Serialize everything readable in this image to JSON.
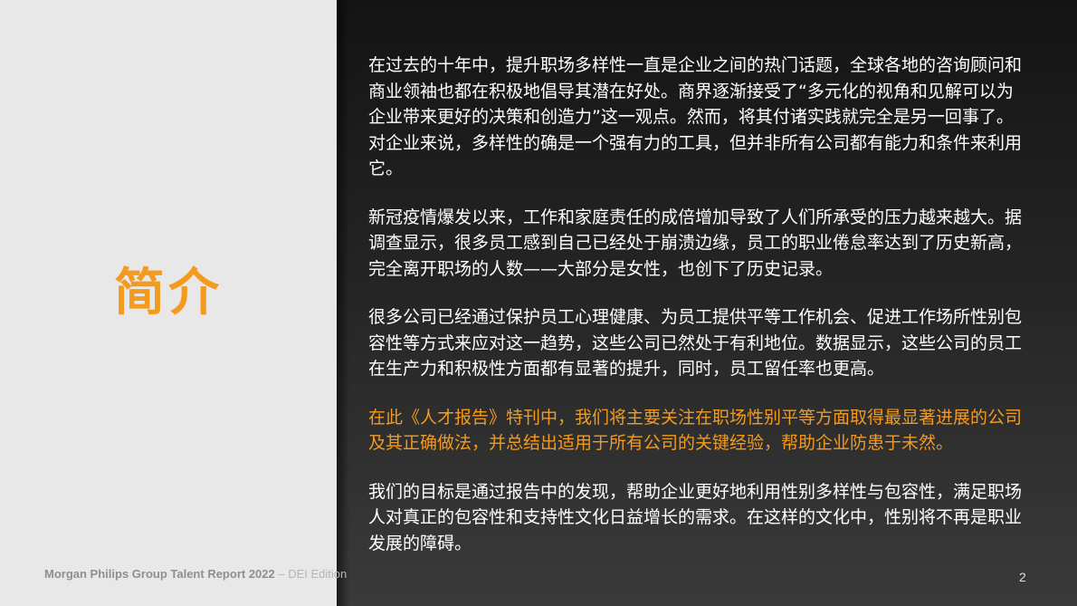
{
  "slide": {
    "title": "简介",
    "paragraphs": [
      "在过去的十年中，提升职场多样性一直是企业之间的热门话题，全球各地的咨询顾问和商业领袖也都在积极地倡导其潜在好处。商界逐渐接受了“多元化的视角和见解可以为企业带来更好的决策和创造力”这一观点。然而，将其付诸实践就完全是另一回事了。对企业来说，多样性的确是一个强有力的工具，但并非所有公司都有能力和条件来利用它。",
      "新冠疫情爆发以来，工作和家庭责任的成倍增加导致了人们所承受的压力越来越大。据调查显示，很多员工感到自己已经处于崩溃边缘，员工的职业倦怠率达到了历史新高，完全离开职场的人数——大部分是女性，也创下了历史记录。",
      "很多公司已经通过保护员工心理健康、为员工提供平等工作机会、促进工作场所性别包容性等方式来应对这一趋势，这些公司已然处于有利地位。数据显示，这些公司的员工在生产力和积极性方面都有显著的提升，同时，员工留任率也更高。",
      "在此《人才报告》特刊中，我们将主要关注在职场性别平等方面取得最显著进展的公司及其正确做法，并总结出适用于所有公司的关键经验，帮助企业防患于未然。",
      "我们的目标是通过报告中的发现，帮助企业更好地利用性别多样性与包容性，满足职场人对真正的包容性和支持性文化日益增长的需求。在这样的文化中，性别将不再是职业发展的障碍。"
    ]
  },
  "footer": {
    "report_name": "Morgan Philips Group Talent Report 2022",
    "edition": " – DEI Edition",
    "page_number": "2"
  },
  "colors": {
    "accent": "#f39a1f",
    "left_panel": "#e8e8e8",
    "right_panel": "#242424",
    "body_text": "#ffffff"
  }
}
